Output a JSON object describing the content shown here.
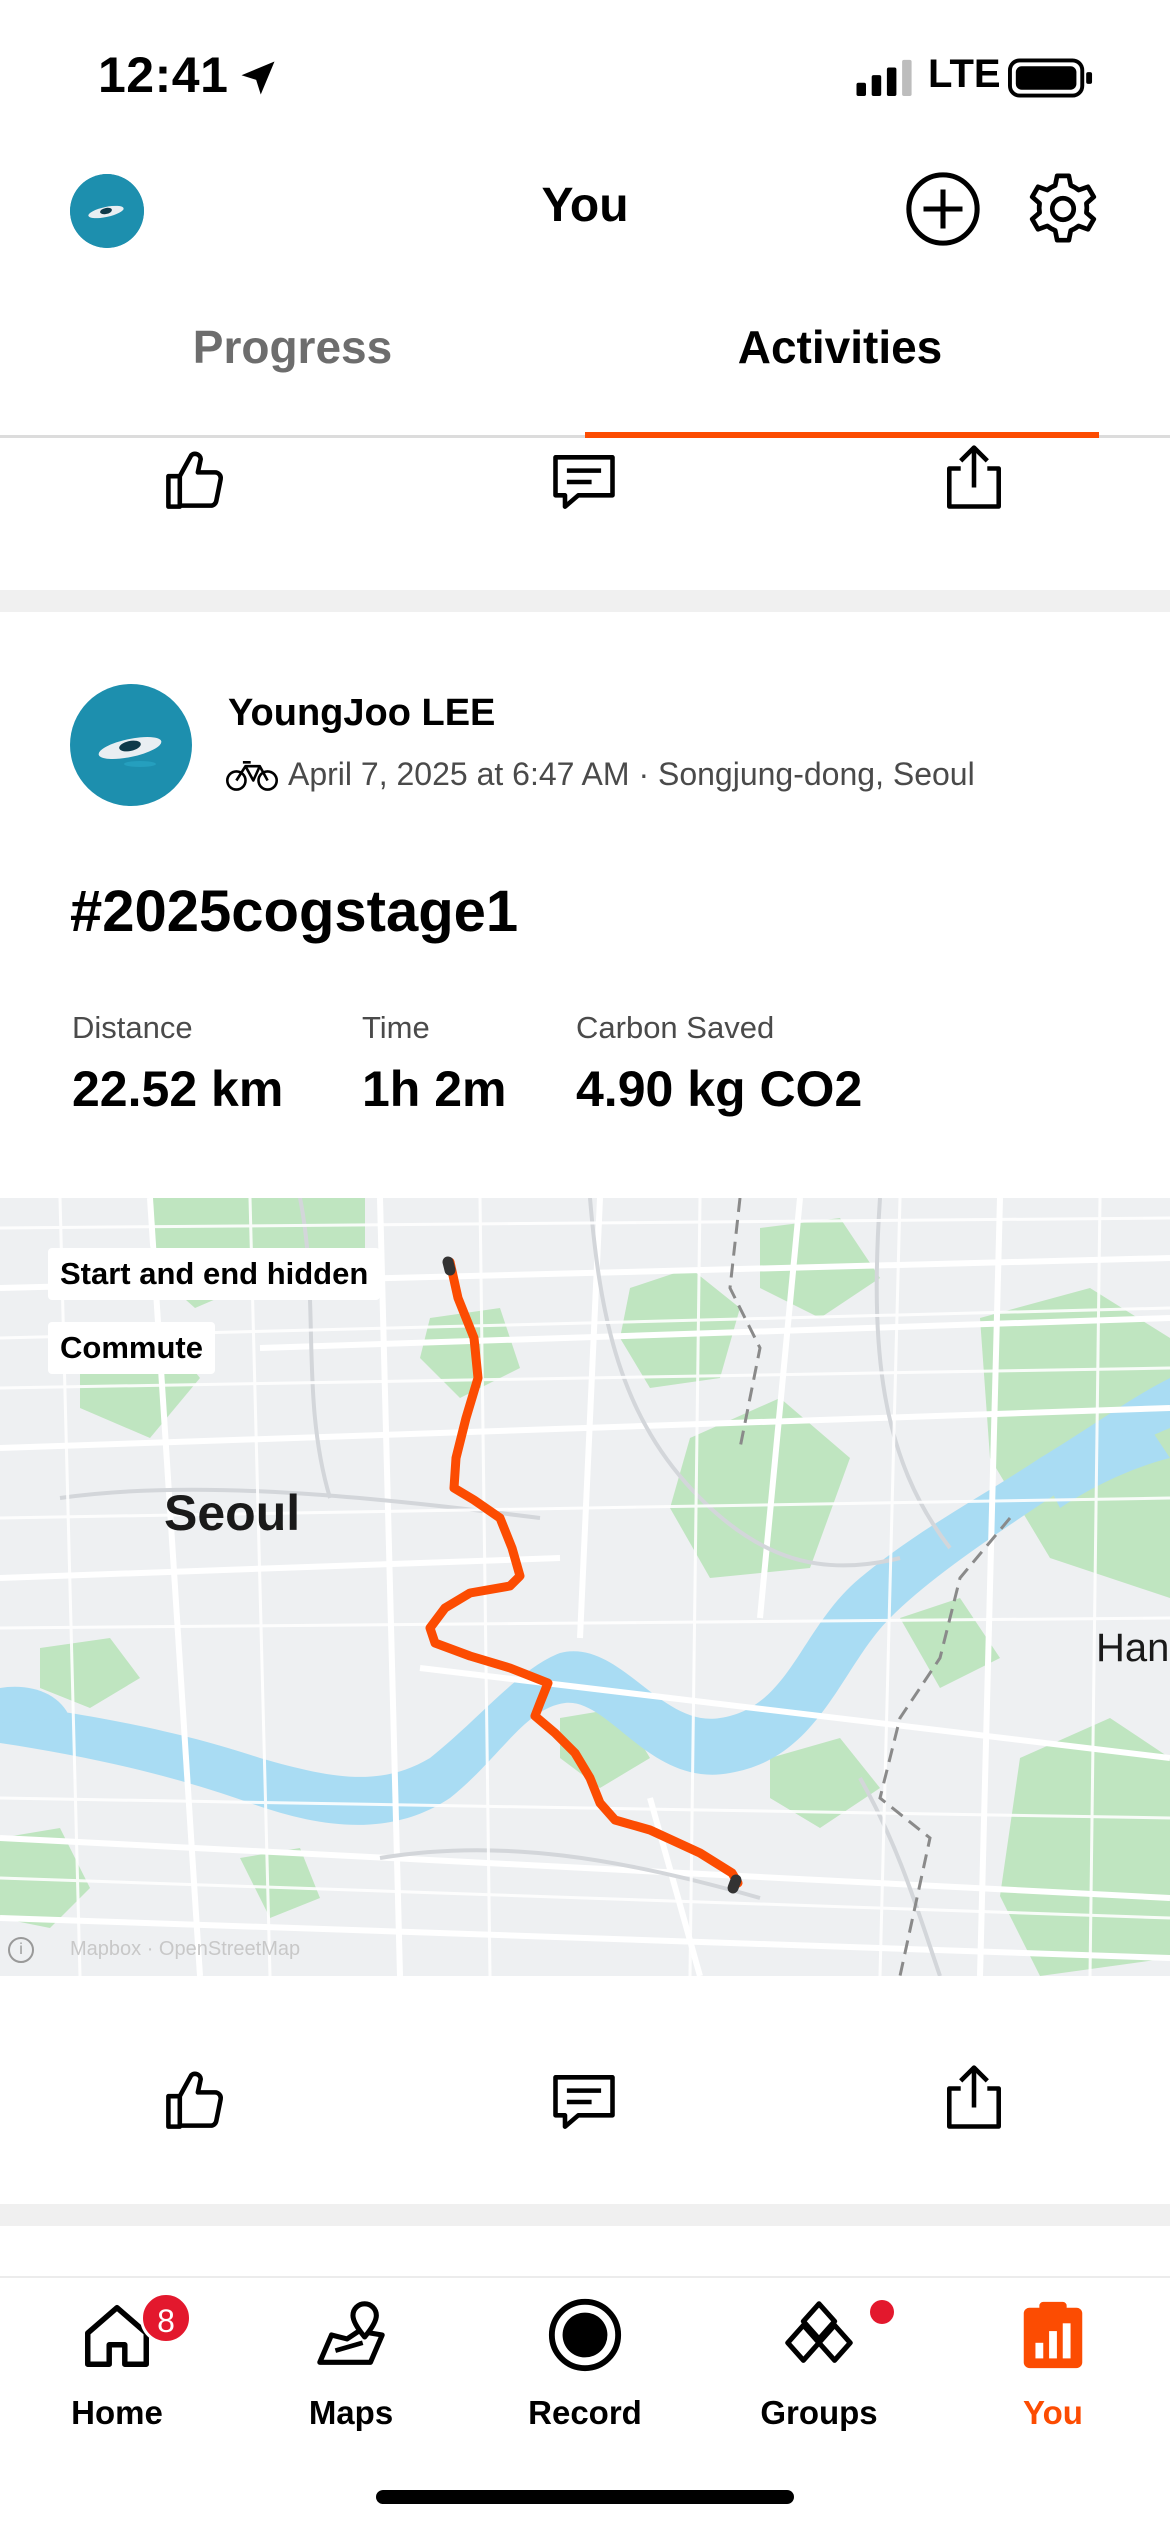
{
  "status_bar": {
    "time": "12:41",
    "network": "LTE"
  },
  "header": {
    "title": "You"
  },
  "tabs": [
    {
      "label": "Progress",
      "selected": false
    },
    {
      "label": "Activities",
      "selected": true
    }
  ],
  "activity": {
    "athlete_name": "YoungJoo LEE",
    "meta": "April 7, 2025 at 6:47 AM · Songjung-dong, Seoul",
    "title": "#2025cogstage1",
    "stats": [
      {
        "label": "Distance",
        "value": "22.52 km"
      },
      {
        "label": "Time",
        "value": "1h 2m"
      },
      {
        "label": "Carbon Saved",
        "value": "4.90 kg CO2"
      }
    ],
    "map": {
      "badges": [
        "Start and end hidden",
        "Commute"
      ],
      "city_label": "Seoul",
      "edge_label": "Han",
      "credit": "Mapbox · OpenStreetMap",
      "route_color": "#fc4c02"
    }
  },
  "bottom_nav": [
    {
      "label": "Home",
      "icon": "home-icon",
      "badge": "8",
      "active": false
    },
    {
      "label": "Maps",
      "icon": "maps-icon",
      "active": false
    },
    {
      "label": "Record",
      "icon": "record-icon",
      "active": false
    },
    {
      "label": "Groups",
      "icon": "groups-icon",
      "dot": true,
      "active": false
    },
    {
      "label": "You",
      "icon": "you-icon",
      "active": true
    }
  ],
  "colors": {
    "accent": "#fc4c02",
    "badge": "#e3182d",
    "water": "#a9dcf3",
    "park": "#bfe5c0"
  }
}
